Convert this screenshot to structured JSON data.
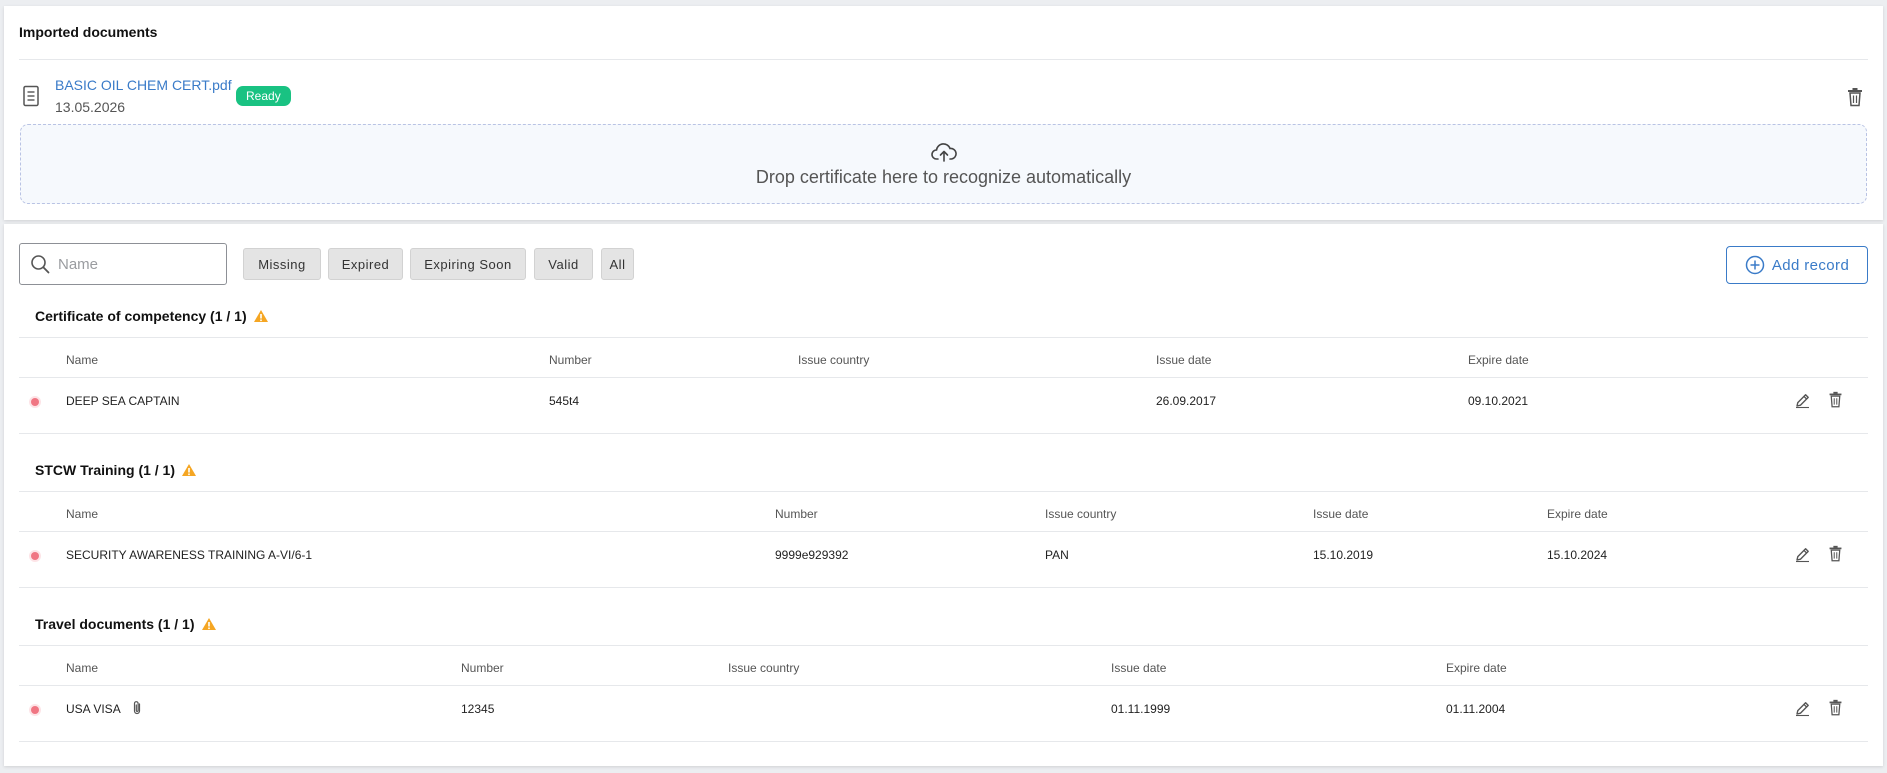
{
  "imported": {
    "title": "Imported documents",
    "file": {
      "name": "BASIC OIL CHEM CERT.pdf",
      "date": "13.05.2026",
      "status": "Ready"
    },
    "dropzone_text": "Drop certificate here to recognize automatically"
  },
  "toolbar": {
    "search_placeholder": "Name",
    "filters": [
      "Missing",
      "Expired",
      "Expiring Soon",
      "Valid",
      "All"
    ],
    "add_label": "Add record"
  },
  "sections": [
    {
      "title": "Certificate of competency (1 / 1)",
      "columns": [
        "Name",
        "Number",
        "Issue country",
        "Issue date",
        "Expire date"
      ],
      "rows": [
        {
          "name": "DEEP SEA CAPTAIN",
          "number": "545t4",
          "country": "",
          "issue": "26.09.2017",
          "expire": "09.10.2021"
        }
      ]
    },
    {
      "title": "STCW Training (1 / 1)",
      "columns": [
        "Name",
        "Number",
        "Issue country",
        "Issue date",
        "Expire date"
      ],
      "rows": [
        {
          "name": "SECURITY AWARENESS TRAINING A-VI/6-1",
          "number": "9999e929392",
          "country": "PAN",
          "issue": "15.10.2019",
          "expire": "15.10.2024"
        }
      ]
    },
    {
      "title": "Travel documents (1 / 1)",
      "columns": [
        "Name",
        "Number",
        "Issue country",
        "Issue date",
        "Expire date"
      ],
      "rows": [
        {
          "name": "USA VISA",
          "number": "12345",
          "country": "",
          "issue": "01.11.1999",
          "expire": "01.11.2004"
        }
      ]
    }
  ],
  "colors": {
    "accent": "#3a7bc8",
    "ready": "#19c282",
    "expired_dot": "#f07683",
    "warning": "#f5a623"
  }
}
